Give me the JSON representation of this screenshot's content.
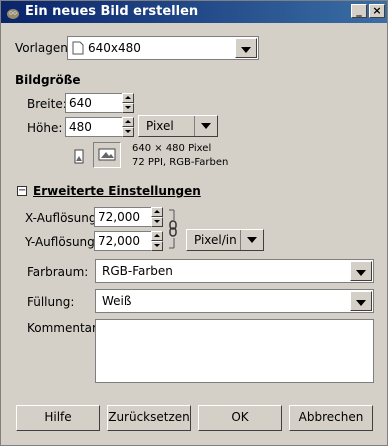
{
  "window": {
    "title": "Ein neues Bild erstellen",
    "icon": "gimp-icon",
    "min_label": "_",
    "close_label": "×"
  },
  "template": {
    "label": "Vorlagen:",
    "value": "640x480"
  },
  "image_size": {
    "heading": "Bildgröße",
    "width_label": "Breite:",
    "width_value": "640",
    "height_label": "Höhe:",
    "height_value": "480",
    "unit": "Pixel",
    "info_line1": "640 × 480 Pixel",
    "info_line2": "72 PPI, RGB-Farben"
  },
  "advanced": {
    "heading": "Erweiterte Einstellungen",
    "expander": "−",
    "xres_label": "X-Auflösung:",
    "xres_value": "72,000",
    "yres_label": "Y-Auflösung:",
    "yres_value": "72,000",
    "res_unit": "Pixel/in",
    "colorspace_label": "Farbraum:",
    "colorspace_value": "RGB-Farben",
    "fill_label": "Füllung:",
    "fill_value": "Weiß",
    "comment_label": "Kommentar:",
    "comment_value": ""
  },
  "buttons": {
    "help": "Hilfe",
    "reset": "Zurücksetzen",
    "ok": "OK",
    "cancel": "Abbrechen"
  }
}
